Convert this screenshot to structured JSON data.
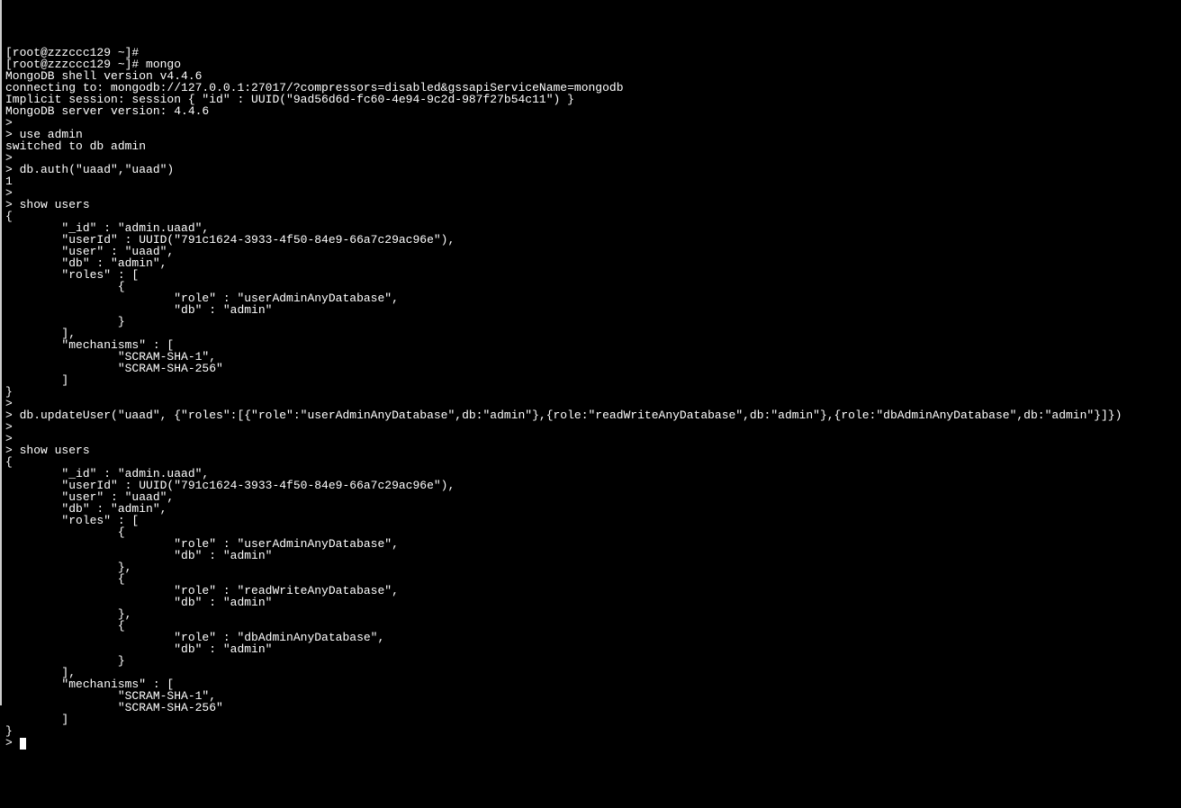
{
  "terminal": {
    "lines": [
      "[root@zzzccc129 ~]#",
      "[root@zzzccc129 ~]# mongo",
      "MongoDB shell version v4.4.6",
      "connecting to: mongodb://127.0.0.1:27017/?compressors=disabled&gssapiServiceName=mongodb",
      "Implicit session: session { \"id\" : UUID(\"9ad56d6d-fc60-4e94-9c2d-987f27b54c11\") }",
      "MongoDB server version: 4.4.6",
      ">",
      "> use admin",
      "switched to db admin",
      ">",
      "> db.auth(\"uaad\",\"uaad\")",
      "1",
      ">",
      "> show users",
      "{",
      "        \"_id\" : \"admin.uaad\",",
      "        \"userId\" : UUID(\"791c1624-3933-4f50-84e9-66a7c29ac96e\"),",
      "        \"user\" : \"uaad\",",
      "        \"db\" : \"admin\",",
      "        \"roles\" : [",
      "                {",
      "                        \"role\" : \"userAdminAnyDatabase\",",
      "                        \"db\" : \"admin\"",
      "                }",
      "        ],",
      "        \"mechanisms\" : [",
      "                \"SCRAM-SHA-1\",",
      "                \"SCRAM-SHA-256\"",
      "        ]",
      "}",
      ">",
      "> db.updateUser(\"uaad\", {\"roles\":[{\"role\":\"userAdminAnyDatabase\",db:\"admin\"},{role:\"readWriteAnyDatabase\",db:\"admin\"},{role:\"dbAdminAnyDatabase\",db:\"admin\"}]})",
      ">",
      ">",
      "> show users",
      "{",
      "        \"_id\" : \"admin.uaad\",",
      "        \"userId\" : UUID(\"791c1624-3933-4f50-84e9-66a7c29ac96e\"),",
      "        \"user\" : \"uaad\",",
      "        \"db\" : \"admin\",",
      "        \"roles\" : [",
      "                {",
      "                        \"role\" : \"userAdminAnyDatabase\",",
      "                        \"db\" : \"admin\"",
      "                },",
      "                {",
      "                        \"role\" : \"readWriteAnyDatabase\",",
      "                        \"db\" : \"admin\"",
      "                },",
      "                {",
      "                        \"role\" : \"dbAdminAnyDatabase\",",
      "                        \"db\" : \"admin\"",
      "                }",
      "        ],",
      "        \"mechanisms\" : [",
      "                \"SCRAM-SHA-1\",",
      "                \"SCRAM-SHA-256\"",
      "        ]",
      "}",
      "> "
    ]
  }
}
